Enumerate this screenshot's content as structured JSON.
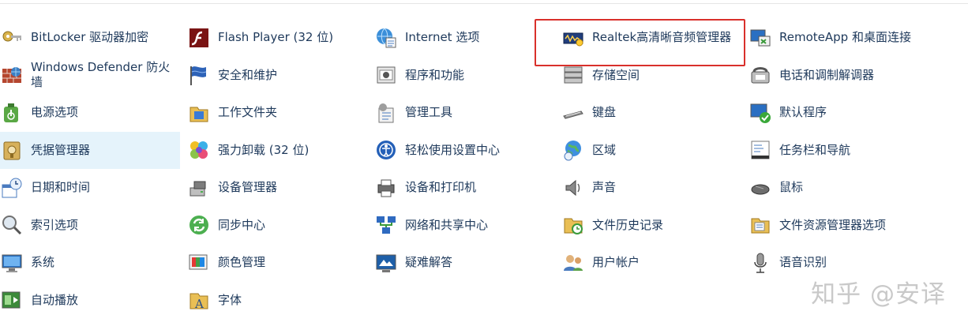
{
  "columns": [
    [
      {
        "label": "BitLocker 驱动器加密",
        "icon": "bitlocker-key-icon"
      },
      {
        "label": "Windows Defender 防火墙",
        "icon": "firewall-icon"
      },
      {
        "label": "电源选项",
        "icon": "power-options-icon"
      },
      {
        "label": "凭据管理器",
        "icon": "credential-manager-icon",
        "selected": true
      },
      {
        "label": "日期和时间",
        "icon": "date-time-icon"
      },
      {
        "label": "索引选项",
        "icon": "indexing-icon"
      },
      {
        "label": "系统",
        "icon": "system-icon"
      },
      {
        "label": "自动播放",
        "icon": "autoplay-icon"
      }
    ],
    [
      {
        "label": "Flash Player (32 位)",
        "icon": "flash-player-icon"
      },
      {
        "label": "安全和维护",
        "icon": "security-flag-icon"
      },
      {
        "label": "工作文件夹",
        "icon": "work-folders-icon"
      },
      {
        "label": "强力卸载 (32 位)",
        "icon": "uninstaller-icon"
      },
      {
        "label": "设备管理器",
        "icon": "device-manager-icon"
      },
      {
        "label": "同步中心",
        "icon": "sync-center-icon"
      },
      {
        "label": "颜色管理",
        "icon": "color-management-icon"
      },
      {
        "label": "字体",
        "icon": "fonts-icon"
      }
    ],
    [
      {
        "label": "Internet 选项",
        "icon": "internet-options-icon"
      },
      {
        "label": "程序和功能",
        "icon": "programs-features-icon"
      },
      {
        "label": "管理工具",
        "icon": "admin-tools-icon"
      },
      {
        "label": "轻松使用设置中心",
        "icon": "ease-of-access-icon"
      },
      {
        "label": "设备和打印机",
        "icon": "printer-icon"
      },
      {
        "label": "网络和共享中心",
        "icon": "network-icon"
      },
      {
        "label": "疑难解答",
        "icon": "troubleshooting-icon"
      }
    ],
    [
      {
        "label": "Realtek高清晰音频管理器",
        "icon": "realtek-audio-icon"
      },
      {
        "label": "存储空间",
        "icon": "storage-spaces-icon"
      },
      {
        "label": "键盘",
        "icon": "keyboard-icon"
      },
      {
        "label": "区域",
        "icon": "region-globe-icon"
      },
      {
        "label": "声音",
        "icon": "speaker-icon"
      },
      {
        "label": "文件历史记录",
        "icon": "file-history-icon"
      },
      {
        "label": "用户帐户",
        "icon": "user-accounts-icon"
      }
    ],
    [
      {
        "label": "RemoteApp 和桌面连接",
        "icon": "remoteapp-icon"
      },
      {
        "label": "电话和调制解调器",
        "icon": "phone-modem-icon"
      },
      {
        "label": "默认程序",
        "icon": "default-programs-icon"
      },
      {
        "label": "任务栏和导航",
        "icon": "taskbar-icon"
      },
      {
        "label": "鼠标",
        "icon": "mouse-icon"
      },
      {
        "label": "文件资源管理器选项",
        "icon": "explorer-options-icon"
      },
      {
        "label": "语音识别",
        "icon": "microphone-icon"
      }
    ]
  ],
  "watermark": "知乎 @安译",
  "colors": {
    "label": "#1e395b",
    "selected_bg": "#e5f3fb",
    "highlight": "#d9302b"
  }
}
